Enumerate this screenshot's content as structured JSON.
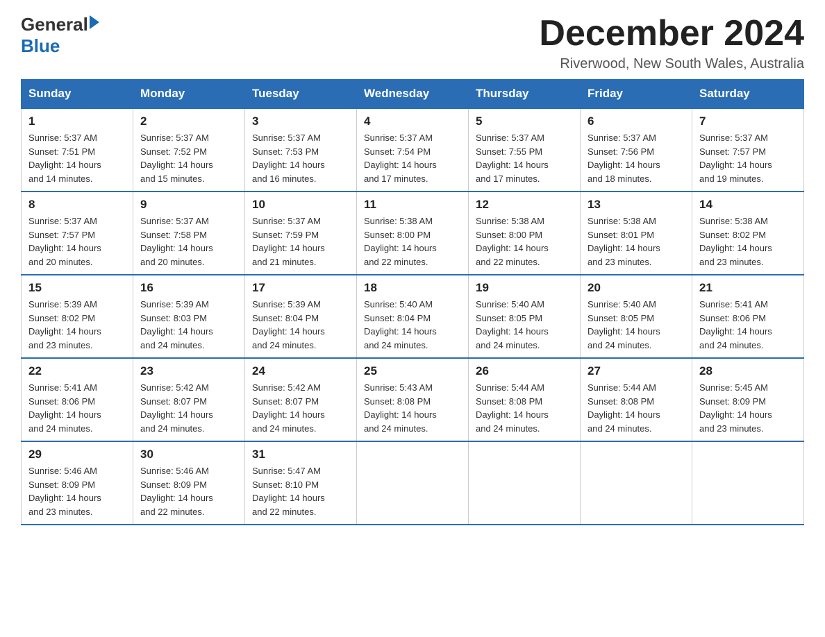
{
  "header": {
    "logo_general": "General",
    "logo_blue": "Blue",
    "month_title": "December 2024",
    "location": "Riverwood, New South Wales, Australia"
  },
  "weekdays": [
    "Sunday",
    "Monday",
    "Tuesday",
    "Wednesday",
    "Thursday",
    "Friday",
    "Saturday"
  ],
  "weeks": [
    [
      {
        "num": "1",
        "sunrise": "5:37 AM",
        "sunset": "7:51 PM",
        "daylight": "14 hours and 14 minutes."
      },
      {
        "num": "2",
        "sunrise": "5:37 AM",
        "sunset": "7:52 PM",
        "daylight": "14 hours and 15 minutes."
      },
      {
        "num": "3",
        "sunrise": "5:37 AM",
        "sunset": "7:53 PM",
        "daylight": "14 hours and 16 minutes."
      },
      {
        "num": "4",
        "sunrise": "5:37 AM",
        "sunset": "7:54 PM",
        "daylight": "14 hours and 17 minutes."
      },
      {
        "num": "5",
        "sunrise": "5:37 AM",
        "sunset": "7:55 PM",
        "daylight": "14 hours and 17 minutes."
      },
      {
        "num": "6",
        "sunrise": "5:37 AM",
        "sunset": "7:56 PM",
        "daylight": "14 hours and 18 minutes."
      },
      {
        "num": "7",
        "sunrise": "5:37 AM",
        "sunset": "7:57 PM",
        "daylight": "14 hours and 19 minutes."
      }
    ],
    [
      {
        "num": "8",
        "sunrise": "5:37 AM",
        "sunset": "7:57 PM",
        "daylight": "14 hours and 20 minutes."
      },
      {
        "num": "9",
        "sunrise": "5:37 AM",
        "sunset": "7:58 PM",
        "daylight": "14 hours and 20 minutes."
      },
      {
        "num": "10",
        "sunrise": "5:37 AM",
        "sunset": "7:59 PM",
        "daylight": "14 hours and 21 minutes."
      },
      {
        "num": "11",
        "sunrise": "5:38 AM",
        "sunset": "8:00 PM",
        "daylight": "14 hours and 22 minutes."
      },
      {
        "num": "12",
        "sunrise": "5:38 AM",
        "sunset": "8:00 PM",
        "daylight": "14 hours and 22 minutes."
      },
      {
        "num": "13",
        "sunrise": "5:38 AM",
        "sunset": "8:01 PM",
        "daylight": "14 hours and 23 minutes."
      },
      {
        "num": "14",
        "sunrise": "5:38 AM",
        "sunset": "8:02 PM",
        "daylight": "14 hours and 23 minutes."
      }
    ],
    [
      {
        "num": "15",
        "sunrise": "5:39 AM",
        "sunset": "8:02 PM",
        "daylight": "14 hours and 23 minutes."
      },
      {
        "num": "16",
        "sunrise": "5:39 AM",
        "sunset": "8:03 PM",
        "daylight": "14 hours and 24 minutes."
      },
      {
        "num": "17",
        "sunrise": "5:39 AM",
        "sunset": "8:04 PM",
        "daylight": "14 hours and 24 minutes."
      },
      {
        "num": "18",
        "sunrise": "5:40 AM",
        "sunset": "8:04 PM",
        "daylight": "14 hours and 24 minutes."
      },
      {
        "num": "19",
        "sunrise": "5:40 AM",
        "sunset": "8:05 PM",
        "daylight": "14 hours and 24 minutes."
      },
      {
        "num": "20",
        "sunrise": "5:40 AM",
        "sunset": "8:05 PM",
        "daylight": "14 hours and 24 minutes."
      },
      {
        "num": "21",
        "sunrise": "5:41 AM",
        "sunset": "8:06 PM",
        "daylight": "14 hours and 24 minutes."
      }
    ],
    [
      {
        "num": "22",
        "sunrise": "5:41 AM",
        "sunset": "8:06 PM",
        "daylight": "14 hours and 24 minutes."
      },
      {
        "num": "23",
        "sunrise": "5:42 AM",
        "sunset": "8:07 PM",
        "daylight": "14 hours and 24 minutes."
      },
      {
        "num": "24",
        "sunrise": "5:42 AM",
        "sunset": "8:07 PM",
        "daylight": "14 hours and 24 minutes."
      },
      {
        "num": "25",
        "sunrise": "5:43 AM",
        "sunset": "8:08 PM",
        "daylight": "14 hours and 24 minutes."
      },
      {
        "num": "26",
        "sunrise": "5:44 AM",
        "sunset": "8:08 PM",
        "daylight": "14 hours and 24 minutes."
      },
      {
        "num": "27",
        "sunrise": "5:44 AM",
        "sunset": "8:08 PM",
        "daylight": "14 hours and 24 minutes."
      },
      {
        "num": "28",
        "sunrise": "5:45 AM",
        "sunset": "8:09 PM",
        "daylight": "14 hours and 23 minutes."
      }
    ],
    [
      {
        "num": "29",
        "sunrise": "5:46 AM",
        "sunset": "8:09 PM",
        "daylight": "14 hours and 23 minutes."
      },
      {
        "num": "30",
        "sunrise": "5:46 AM",
        "sunset": "8:09 PM",
        "daylight": "14 hours and 22 minutes."
      },
      {
        "num": "31",
        "sunrise": "5:47 AM",
        "sunset": "8:10 PM",
        "daylight": "14 hours and 22 minutes."
      },
      null,
      null,
      null,
      null
    ]
  ],
  "labels": {
    "sunrise": "Sunrise:",
    "sunset": "Sunset:",
    "daylight": "Daylight:"
  }
}
